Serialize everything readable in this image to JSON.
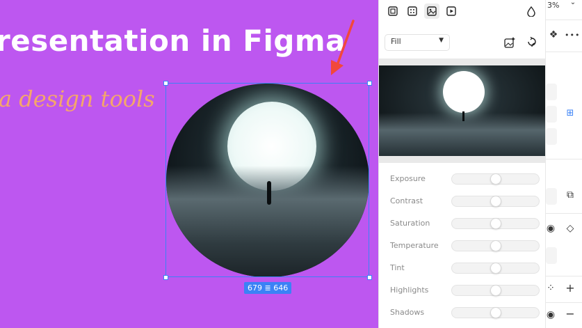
{
  "canvas": {
    "title": "resentation in Figma",
    "subtitle": "a design tools",
    "dimensions_label": "679 × 646",
    "dimension_w": "679",
    "dimension_h": "646"
  },
  "panel": {
    "fill_select": {
      "value": "Fill"
    },
    "adjustments": [
      {
        "label": "Exposure",
        "value": 0.5
      },
      {
        "label": "Contrast",
        "value": 0.5
      },
      {
        "label": "Saturation",
        "value": 0.5
      },
      {
        "label": "Temperature",
        "value": 0.5
      },
      {
        "label": "Tint",
        "value": 0.5
      },
      {
        "label": "Highlights",
        "value": 0.5
      },
      {
        "label": "Shadows",
        "value": 0.5
      }
    ]
  },
  "right_sidebar": {
    "zoom_partial": "3%",
    "more_label": "•••"
  },
  "colors": {
    "canvas_bg": "#bd57f0",
    "selection": "#3b82f6",
    "subtitle": "#f5a66a",
    "arrow": "#f2483b"
  },
  "icons": [
    "image-icon",
    "grid-icon",
    "crop-icon",
    "video-icon",
    "drop-icon",
    "chevron-down-icon",
    "ai-image-icon",
    "rotate-icon"
  ]
}
